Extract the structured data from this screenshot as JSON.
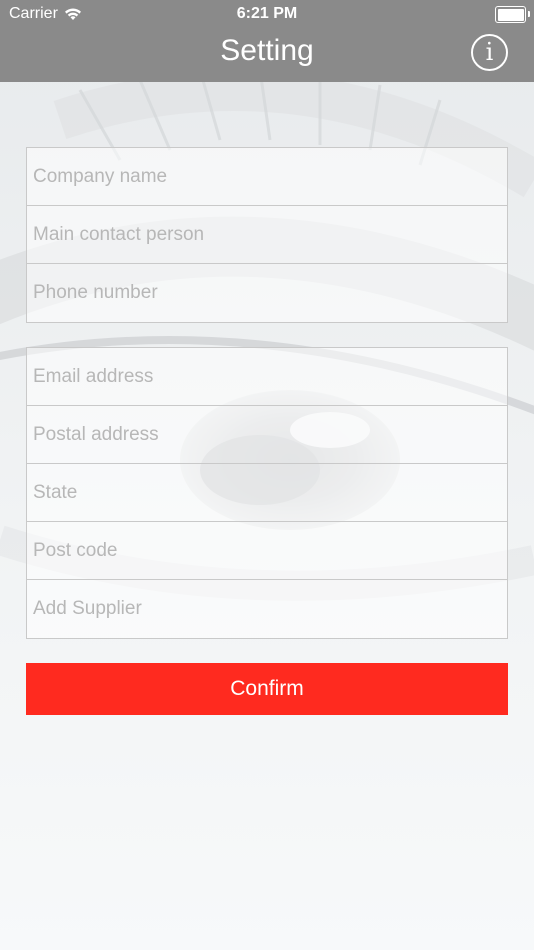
{
  "status_bar": {
    "carrier": "Carrier",
    "time": "6:21 PM"
  },
  "nav": {
    "title": "Setting",
    "info_icon": "info-icon"
  },
  "form": {
    "group_1": [
      {
        "placeholder": "Company name",
        "value": ""
      },
      {
        "placeholder": "Main contact person",
        "value": ""
      },
      {
        "placeholder": "Phone number",
        "value": ""
      }
    ],
    "group_2": [
      {
        "placeholder": "Email address",
        "value": ""
      },
      {
        "placeholder": "Postal address",
        "value": ""
      },
      {
        "placeholder": "State",
        "value": ""
      },
      {
        "placeholder": "Post code",
        "value": ""
      },
      {
        "placeholder": "Add Supplier",
        "value": ""
      }
    ]
  },
  "confirm_label": "Confirm",
  "colors": {
    "nav_background": "#8a8a8a",
    "confirm_button": "#ff2a1f",
    "page_background": "#f6f8f9"
  }
}
